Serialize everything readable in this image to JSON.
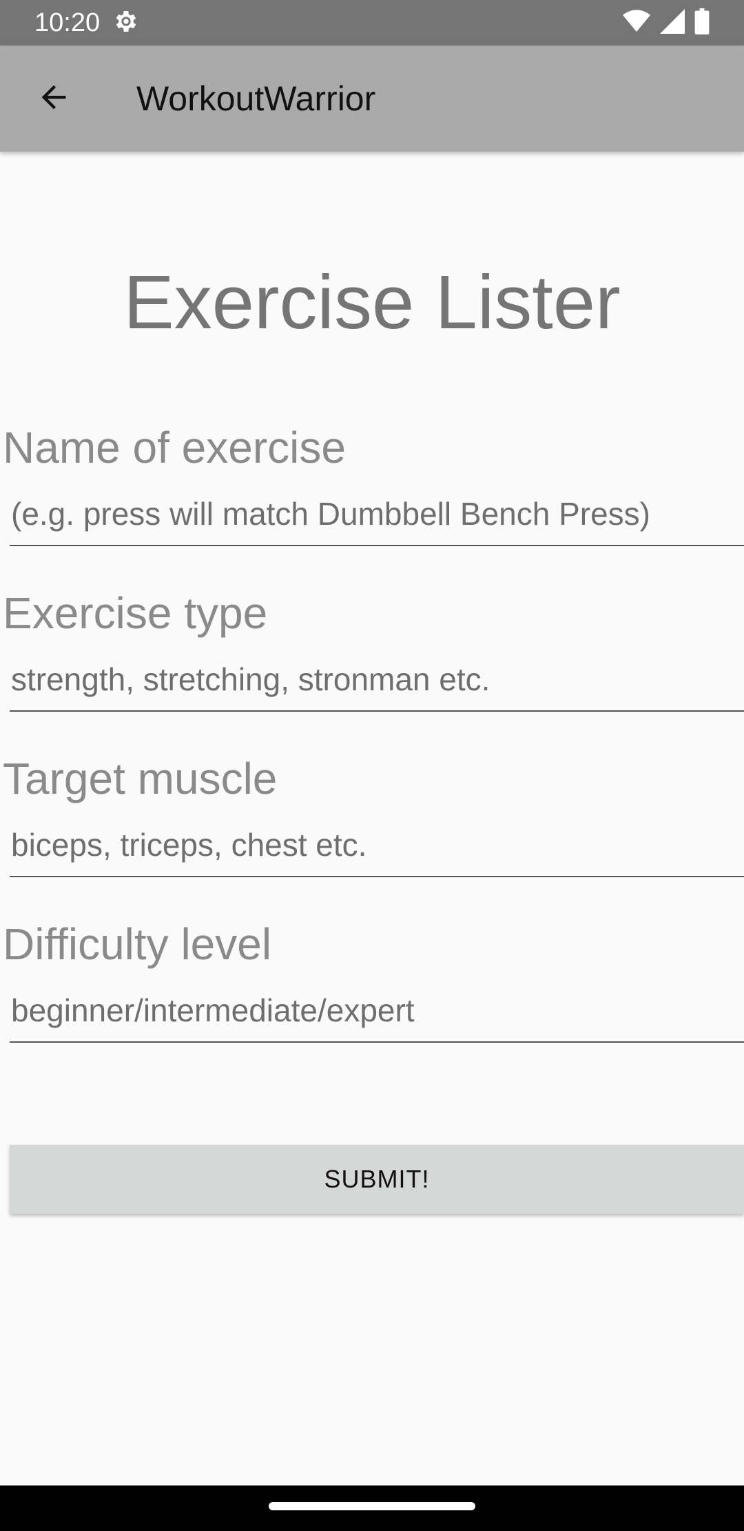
{
  "status_bar": {
    "time": "10:20",
    "icons": [
      "settings-gear-icon",
      "wifi-icon",
      "signal-icon",
      "battery-icon"
    ]
  },
  "app_bar": {
    "title": "WorkoutWarrior",
    "back_icon": "arrow-back-icon"
  },
  "page": {
    "title": "Exercise Lister"
  },
  "form": {
    "fields": [
      {
        "label": "Name of exercise",
        "placeholder": "(e.g. press will match Dumbbell Bench Press)",
        "value": ""
      },
      {
        "label": "Exercise type",
        "placeholder": "strength, stretching, stronman etc.",
        "value": ""
      },
      {
        "label": "Target muscle",
        "placeholder": "biceps, triceps, chest etc.",
        "value": ""
      },
      {
        "label": "Difficulty level",
        "placeholder": "beginner/intermediate/expert",
        "value": ""
      }
    ],
    "submit_label": "SUBMIT!"
  },
  "colors": {
    "status_bar": "#757575",
    "app_bar": "#aaaaaa",
    "background": "#fafafa",
    "button": "#d6d7d7",
    "label_text": "#8a8a8a"
  }
}
